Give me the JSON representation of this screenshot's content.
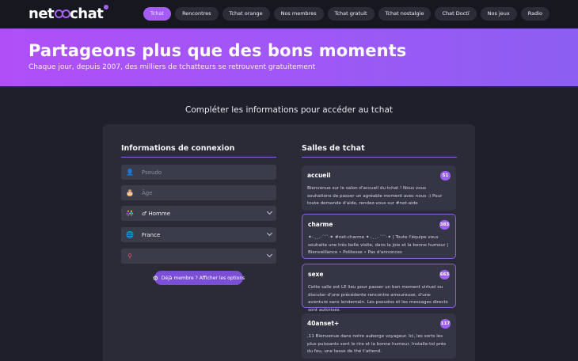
{
  "logo": {
    "text_left": "net",
    "text_right": "chat"
  },
  "nav": {
    "items": [
      {
        "label": "Tchat",
        "active": true
      },
      {
        "label": "Rencontres",
        "active": false
      },
      {
        "label": "Tchat orange",
        "active": false
      },
      {
        "label": "Nos membres",
        "active": false
      },
      {
        "label": "Tchat gratuit",
        "active": false
      },
      {
        "label": "Tchat nostalgie",
        "active": false
      },
      {
        "label": "Chat Doctï",
        "active": false
      },
      {
        "label": "Nos jeux",
        "active": false
      },
      {
        "label": "Radio",
        "active": false
      }
    ]
  },
  "hero": {
    "title": "Partageons plus que des bons moments",
    "subtitle": "Chaque jour, depuis 2007, des milliers de tchatteurs se retrouvent gratuitement"
  },
  "main": {
    "heading": "Compléter les informations pour accéder au tchat"
  },
  "login": {
    "title": "Informations de connexion",
    "pseudo_placeholder": "Pseudo",
    "age_placeholder": "Âge",
    "gender_value": "Homme",
    "country_value": "France",
    "city_value": "",
    "options_button": "Déjà membre ? Afficher les options",
    "icons": {
      "pseudo": "user-icon",
      "age": "cake-icon",
      "gender": "gender-icon",
      "country": "globe-icon",
      "city": "map-pin-icon",
      "options": "gear-icon"
    }
  },
  "rooms": {
    "title": "Salles de tchat",
    "list": [
      {
        "name": "accueil",
        "count": "51",
        "desc": "Bienvenue sur le salon d'accueil du tchat ! Nous vous souhaitons de passer un agréable moment avec nous :) Pour toute demande d'aide, rendez-vous sur #net-aide",
        "highlighted": false
      },
      {
        "name": "charme",
        "count": "383",
        "desc": "✦·.¸¸.·´¯`·✦ #net-charme ✦·.¸¸.·´¯`·✦ | Toute l'équipe vous souhaite une très belle visite, dans la joie et la bonne humeur | Bienveillance • Politesse • Pas d'annonces",
        "highlighted": true
      },
      {
        "name": "sexe",
        "count": "663",
        "desc": "Cette salle est LE lieu pour passer un bon moment virtuel ou discuter d'une précédente rencontre amoureuse, d'une aventure sans lendemain. Les pseudos et les messages directs sont autorisés.",
        "highlighted": true
      },
      {
        "name": "40anset+",
        "count": "117",
        "desc": ",11 Bienvenue dans notre auberge voyageur. Ici, les sorts les plus puissants sont le rire et la bonne humeur. Installe-toi près du feu, une tasse de thé t'attend.",
        "highlighted": false
      }
    ]
  },
  "colors": {
    "accent": "#a55cf4",
    "background": "#1e1f2b",
    "panel": "#2a2b37",
    "field": "#3b3c4a",
    "room_card": "#353645"
  }
}
